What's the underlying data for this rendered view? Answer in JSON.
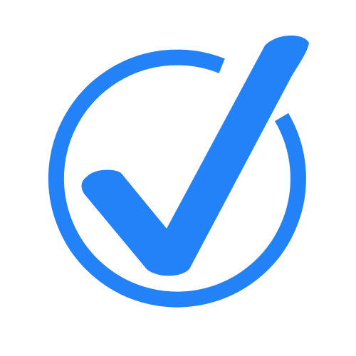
{
  "icon": {
    "name": "check-circle-icon",
    "accent_color": "#2482F9",
    "background_color": "#FFFFFF"
  }
}
